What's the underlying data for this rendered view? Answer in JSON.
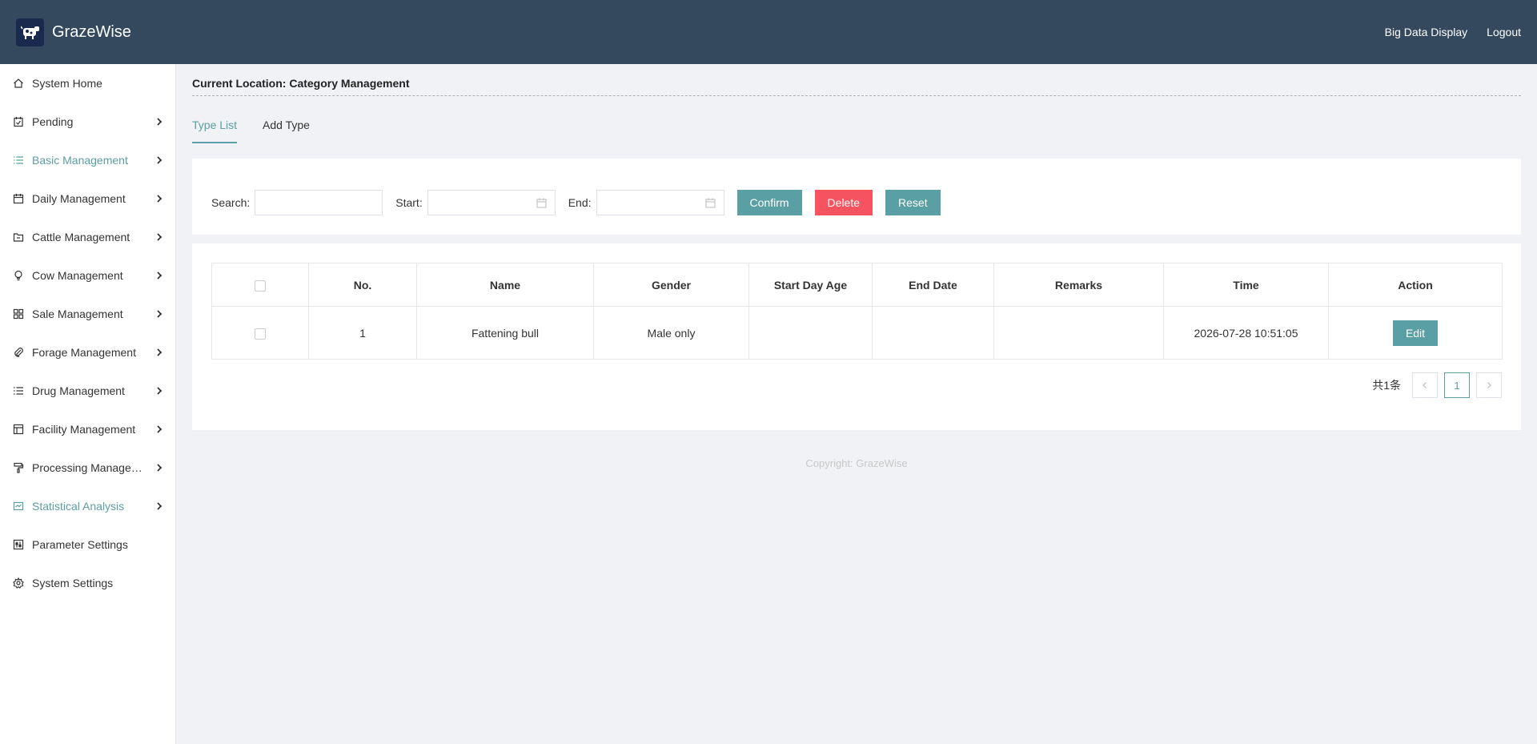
{
  "header": {
    "brand": "GrazeWise",
    "links": [
      "Big Data Display",
      "Logout"
    ]
  },
  "sidebar": {
    "items": [
      {
        "label": "System Home",
        "icon": "home-icon",
        "has_children": false,
        "accent": false
      },
      {
        "label": "Pending",
        "icon": "pending-icon",
        "has_children": true,
        "accent": false
      },
      {
        "label": "Basic Management",
        "icon": "list-icon",
        "has_children": true,
        "accent": true
      },
      {
        "label": "Daily Management",
        "icon": "calendar-icon",
        "has_children": true,
        "accent": false
      },
      {
        "label": "Cattle Management",
        "icon": "folder-icon",
        "has_children": true,
        "accent": false
      },
      {
        "label": "Cow Management",
        "icon": "bulb-icon",
        "has_children": true,
        "accent": false
      },
      {
        "label": "Sale Management",
        "icon": "grid-icon",
        "has_children": true,
        "accent": false
      },
      {
        "label": "Forage Management",
        "icon": "paperclip-icon",
        "has_children": true,
        "accent": false
      },
      {
        "label": "Drug Management",
        "icon": "list-icon",
        "has_children": true,
        "accent": false
      },
      {
        "label": "Facility Management",
        "icon": "layout-icon",
        "has_children": true,
        "accent": false
      },
      {
        "label": "Processing Management",
        "icon": "paint-roller-icon",
        "has_children": true,
        "accent": false
      },
      {
        "label": "Statistical Analysis",
        "icon": "chart-icon",
        "has_children": true,
        "accent": true
      },
      {
        "label": "Parameter Settings",
        "icon": "sliders-icon",
        "has_children": false,
        "accent": false
      },
      {
        "label": "System Settings",
        "icon": "gear-icon",
        "has_children": false,
        "accent": false
      }
    ]
  },
  "location": "Current Location: Category Management",
  "tabs": [
    {
      "label": "Type List",
      "active": true
    },
    {
      "label": "Add Type",
      "active": false
    }
  ],
  "filter": {
    "search_label": "Search:",
    "search_value": "",
    "start_label": "Start:",
    "start_value": "",
    "end_label": "End:",
    "end_value": "",
    "confirm": "Confirm",
    "delete": "Delete",
    "reset": "Reset"
  },
  "table": {
    "columns": [
      "No.",
      "Name",
      "Gender",
      "Start Day Age",
      "End Date",
      "Remarks",
      "Time",
      "Action"
    ],
    "rows": [
      {
        "no": "1",
        "name": "Fattening bull",
        "gender": "Male only",
        "start_day_age": "",
        "end_date": "",
        "remarks": "",
        "time": "2026-07-28 10:51:05",
        "action": "Edit"
      }
    ]
  },
  "pagination": {
    "total": "共1条",
    "current_page": "1"
  },
  "footer": {
    "copyright": "Copyright: GrazeWise"
  },
  "colors": {
    "header_bg": "#34495e",
    "accent": "#5a9fa3",
    "danger": "#f5535f",
    "page_bg": "#f0f2f5"
  }
}
